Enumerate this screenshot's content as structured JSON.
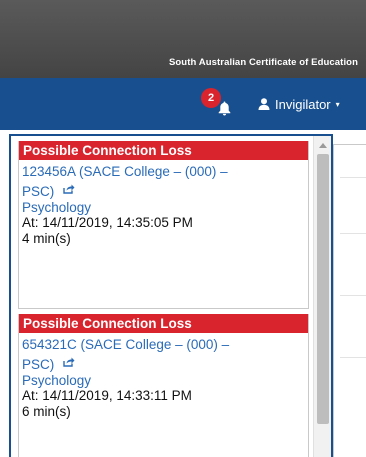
{
  "header": {
    "brand": "South Australian Certificate of Education"
  },
  "navbar": {
    "notification_count": "2",
    "user_label": "Invigilator",
    "user_caret": "▾"
  },
  "notifications": [
    {
      "title": "Possible Connection Loss",
      "student_line1": "123456A (SACE College – (000) –",
      "student_line2": "PSC)",
      "subject": "Psychology",
      "at": "At: 14/11/2019, 14:35:05 PM",
      "duration": "4 min(s)"
    },
    {
      "title": "Possible Connection Loss",
      "student_line1": "654321C (SACE College – (000) –",
      "student_line2": "PSC)",
      "subject": "Psychology",
      "at": "At: 14/11/2019, 14:33:11 PM",
      "duration": "6 min(s)"
    }
  ],
  "colors": {
    "header_bg": "#4a4a4a",
    "navbar_bg": "#18508f",
    "alert_red": "#d9232d",
    "link_blue": "#2a6bb8"
  }
}
